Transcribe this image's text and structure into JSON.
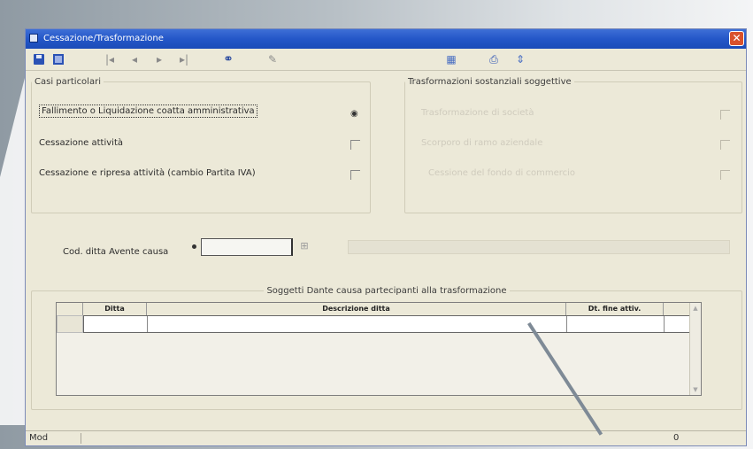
{
  "window": {
    "title": "Cessazione/Trasformazione"
  },
  "toolbar": {
    "icons": [
      "save-icon",
      "grid-icon",
      "first-record-icon",
      "prev-record-icon",
      "next-record-icon",
      "last-record-icon",
      "binoculars-icon",
      "edit-icon",
      "calculator-icon",
      "print-icon",
      "help-icon"
    ]
  },
  "casi": {
    "legend": "Casi particolari",
    "items": [
      {
        "label": "Fallimento o Liquidazione coatta amministrativa",
        "checked": true
      },
      {
        "label": "Cessazione attività",
        "checked": false
      },
      {
        "label": "Cessazione e ripresa attività (cambio Partita IVA)",
        "checked": false
      }
    ]
  },
  "trasformazioni": {
    "legend": "Trasformazioni sostanziali soggettive",
    "items": [
      {
        "label": "Trasformazione di società",
        "checked": false
      },
      {
        "label": "Scorporo di ramo aziendale",
        "checked": false
      },
      {
        "label": "Cessione del fondo di commercio",
        "checked": false
      }
    ]
  },
  "cod_ditta": {
    "label": "Cod. ditta Avente causa",
    "value": ""
  },
  "soggetti": {
    "legend": "Soggetti Dante causa partecipanti alla trasformazione",
    "columns": [
      "Ditta",
      "Descrizione ditta",
      "Dt. fine attiv."
    ]
  },
  "status": {
    "mode": "Mod",
    "count": "0"
  }
}
